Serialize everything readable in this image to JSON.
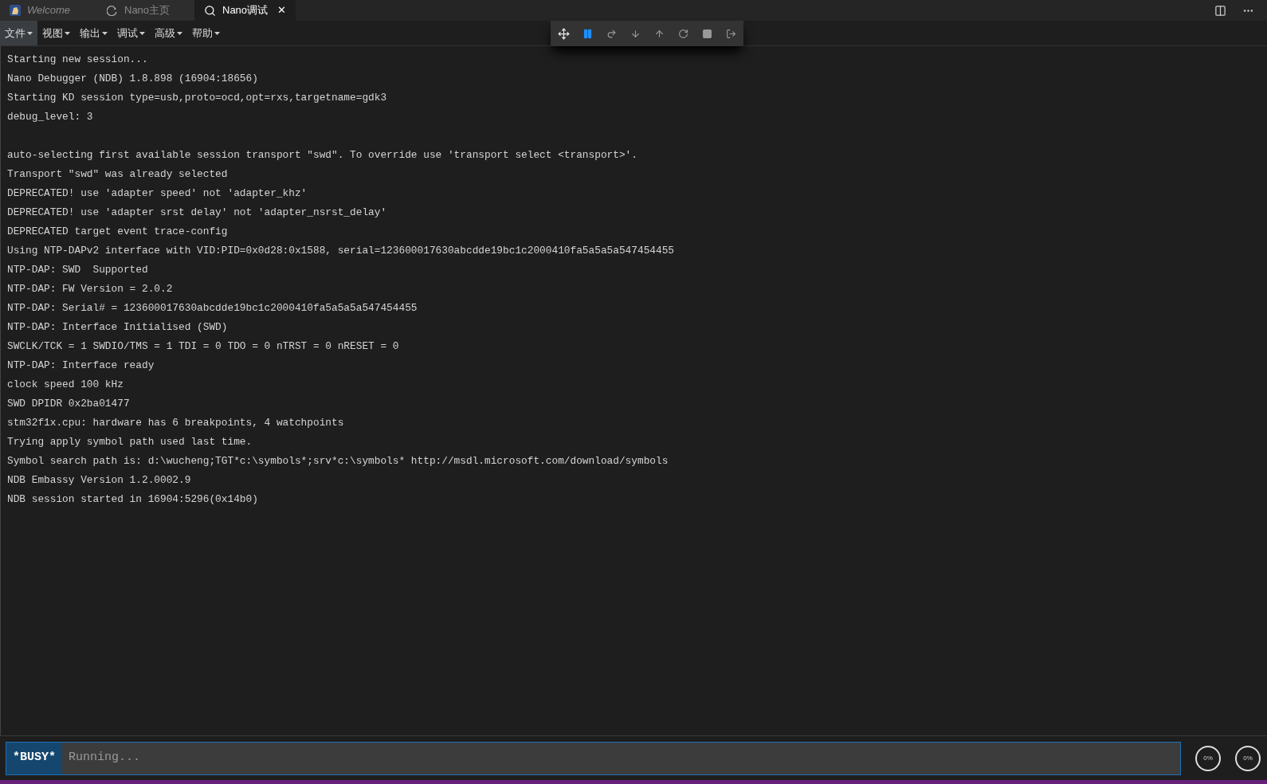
{
  "tabs": [
    {
      "label": "Welcome",
      "selected": false,
      "kind": "welcome"
    },
    {
      "label": "Nano主页",
      "selected": false,
      "kind": "home"
    },
    {
      "label": "Nano调试",
      "selected": true,
      "kind": "debug",
      "close": "✕"
    }
  ],
  "menu": [
    {
      "label": "文件",
      "selected": true
    },
    {
      "label": "视图",
      "selected": false
    },
    {
      "label": "输出",
      "selected": false
    },
    {
      "label": "调试",
      "selected": false
    },
    {
      "label": "高级",
      "selected": false
    },
    {
      "label": "帮助",
      "selected": false
    }
  ],
  "debug_toolbar": [
    {
      "kind": "move",
      "active": false
    },
    {
      "kind": "pause",
      "active": true
    },
    {
      "kind": "step-over",
      "active": false
    },
    {
      "kind": "step-into",
      "active": false
    },
    {
      "kind": "step-out",
      "active": false
    },
    {
      "kind": "restart",
      "active": false
    },
    {
      "kind": "stop",
      "active": false
    },
    {
      "kind": "disconnect",
      "active": false
    }
  ],
  "console_blocks": [
    [
      "Starting new session...",
      "Nano Debugger (NDB) 1.8.898 (16904:18656)",
      "Starting KD session type=usb,proto=ocd,opt=rxs,targetname=gdk3",
      "debug_level: 3"
    ],
    [
      "auto-selecting first available session transport \"swd\". To override use 'transport select <transport>'.",
      "Transport \"swd\" was already selected",
      "DEPRECATED! use 'adapter speed' not 'adapter_khz'",
      "DEPRECATED! use 'adapter srst delay' not 'adapter_nsrst_delay'",
      "DEPRECATED target event trace-config",
      "Using NTP-DAPv2 interface with VID:PID=0x0d28:0x1588, serial=123600017630abcdde19bc1c2000410fa5a5a5a547454455",
      "NTP-DAP: SWD  Supported",
      "NTP-DAP: FW Version = 2.0.2",
      "NTP-DAP: Serial# = 123600017630abcdde19bc1c2000410fa5a5a5a547454455",
      "NTP-DAP: Interface Initialised (SWD)",
      "SWCLK/TCK = 1 SWDIO/TMS = 1 TDI = 0 TDO = 0 nTRST = 0 nRESET = 0",
      "NTP-DAP: Interface ready",
      "clock speed 100 kHz",
      "SWD DPIDR 0x2ba01477",
      "stm32f1x.cpu: hardware has 6 breakpoints, 4 watchpoints",
      "Trying apply symbol path used last time.",
      "Symbol search path is: d:\\wucheng;TGT*c:\\symbols*;srv*c:\\symbols* http://msdl.microsoft.com/download/symbols",
      "NDB Embassy Version 1.2.0002.9",
      "NDB session started in 16904:5296(0x14b0)"
    ]
  ],
  "command_bar": {
    "status": "*BUSY*",
    "value": "Running..."
  },
  "gauges": [
    {
      "label": "0%"
    },
    {
      "label": "0%"
    }
  ]
}
